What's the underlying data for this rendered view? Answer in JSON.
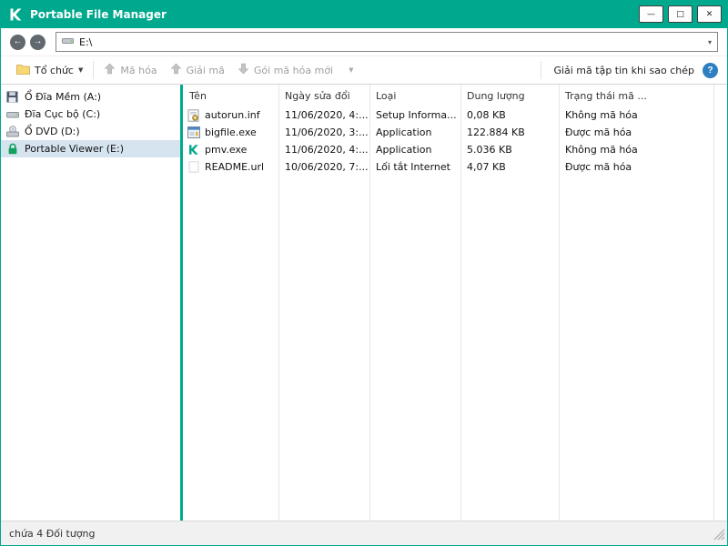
{
  "colors": {
    "brand": "#00a88e",
    "selection": "#d6e4f0",
    "help_blue": "#2d7fc1"
  },
  "window": {
    "title": "Portable File Manager"
  },
  "icons": {
    "kaspersky_logo": "kaspersky-k",
    "minimize": "—",
    "maximize": "□",
    "close": "✕",
    "back": "←",
    "forward": "→",
    "caret": "▼",
    "combo_caret": "▾",
    "help": "?"
  },
  "navbar": {
    "address": "E:\\"
  },
  "toolbar": {
    "organize": "Tổ chức",
    "encrypt": "Mã hóa",
    "decrypt": "Giải mã",
    "new_package": "Gói mã hóa mới",
    "decrypt_on_copy": "Giải mã tập tin khi sao chép"
  },
  "sidebar": {
    "items": [
      {
        "label": "Ổ Đĩa Mềm (A:)",
        "icon": "floppy-icon",
        "selected": false
      },
      {
        "label": "Đĩa Cục bộ (C:)",
        "icon": "hard-drive-icon",
        "selected": false
      },
      {
        "label": "Ổ DVD (D:)",
        "icon": "dvd-drive-icon",
        "selected": false
      },
      {
        "label": "Portable Viewer (E:)",
        "icon": "lock-icon",
        "selected": true
      }
    ]
  },
  "filelist": {
    "columns": [
      "Tên",
      "Ngày sửa đổi",
      "Loại",
      "Dung lượng",
      "Trạng thái mã ..."
    ],
    "rows": [
      {
        "name": "autorun.inf",
        "icon": "setup-file-icon",
        "date": "11/06/2020, 4:...",
        "type": "Setup Informa...",
        "size": "0,08 KB",
        "status": "Không mã hóa"
      },
      {
        "name": "bigfile.exe",
        "icon": "application-file-icon",
        "date": "11/06/2020, 3:...",
        "type": "Application",
        "size": "122.884 KB",
        "status": "Được mã hóa"
      },
      {
        "name": "pmv.exe",
        "icon": "kaspersky-app-icon",
        "date": "11/06/2020, 4:...",
        "type": "Application",
        "size": "5.036 KB",
        "status": "Không mã hóa"
      },
      {
        "name": "README.url",
        "icon": "url-file-icon",
        "date": "10/06/2020, 7:...",
        "type": "Lối tắt Internet",
        "size": "4,07 KB",
        "status": "Được mã hóa"
      }
    ]
  },
  "statusbar": {
    "text": "chứa 4 Đối tượng"
  }
}
